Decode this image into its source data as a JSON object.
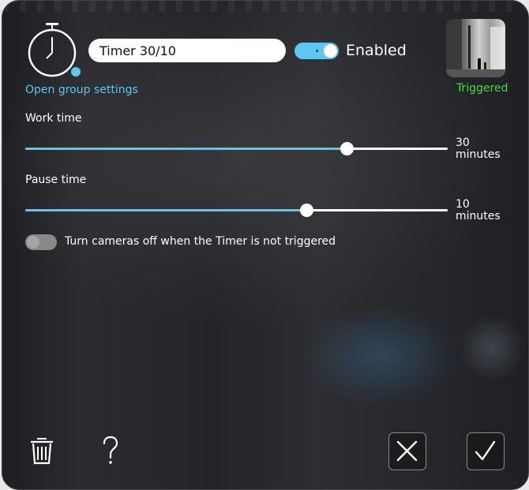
{
  "header": {
    "timer_name": "Timer 30/10",
    "enabled_label": "Enabled",
    "enabled": true,
    "open_group_settings": "Open group settings",
    "camera_status": "Triggered"
  },
  "work_time": {
    "label": "Work time",
    "value": "30",
    "unit": "minutes",
    "fraction": 0.76
  },
  "pause_time": {
    "label": "Pause time",
    "value": "10",
    "unit": "minutes",
    "fraction": 0.665
  },
  "cameras_off": {
    "label": "Turn cameras off when the Timer is not triggered",
    "enabled": false
  },
  "footer": {
    "delete_icon": "trash-icon",
    "help_icon": "question-icon",
    "cancel_icon": "close-icon",
    "confirm_icon": "check-icon"
  },
  "colors": {
    "accent": "#5ec6f0",
    "triggered": "#3ddc3d"
  }
}
